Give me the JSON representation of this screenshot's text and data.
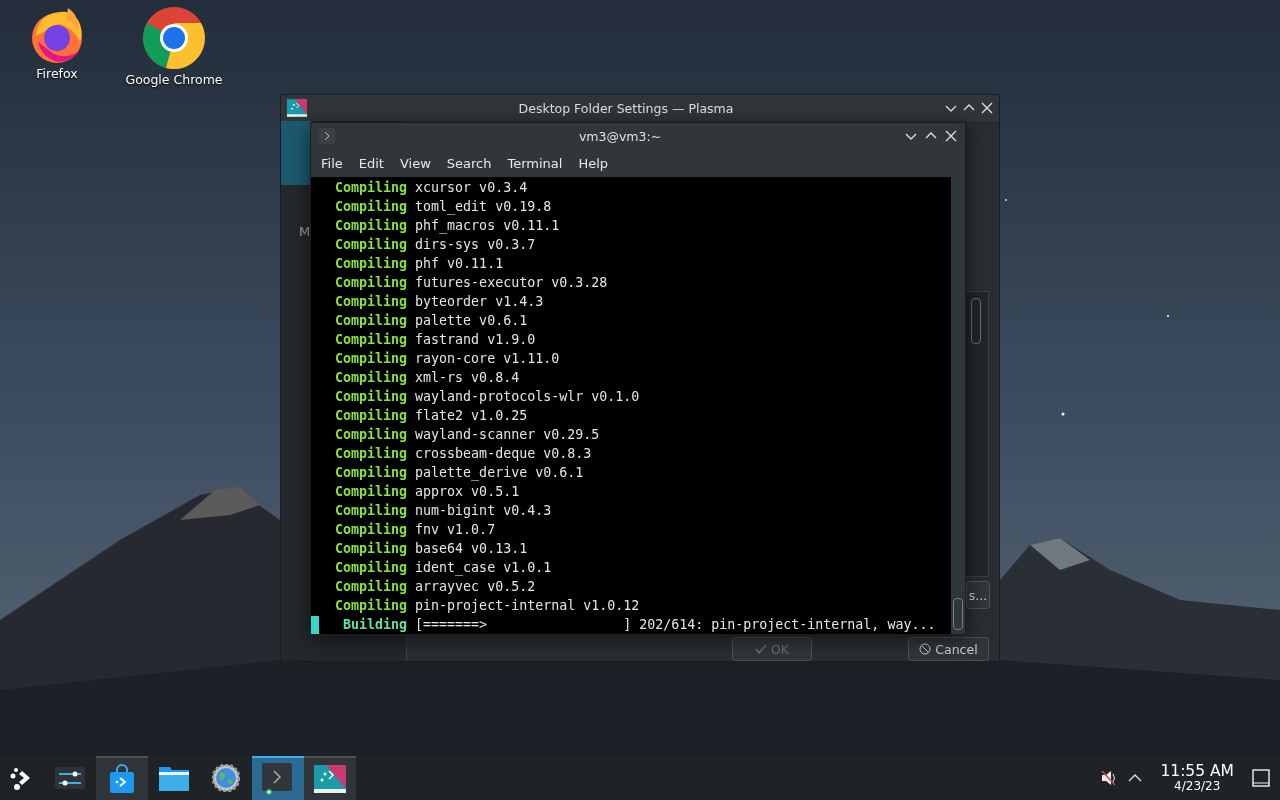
{
  "desktop_icons": [
    {
      "kind": "firefox",
      "label": "Firefox"
    },
    {
      "kind": "chrome",
      "label": "Google Chrome"
    }
  ],
  "back_window": {
    "title": "Desktop Folder Settings — Plasma",
    "side_label": "M",
    "buttons": [
      {
        "kind": "more",
        "label": "s...",
        "disabled": false
      },
      {
        "kind": "ok",
        "label": "OK",
        "disabled": true
      },
      {
        "kind": "cancel",
        "label": "Cancel",
        "disabled": false
      }
    ]
  },
  "terminal": {
    "title": "vm3@vm3:~",
    "menu": [
      "File",
      "Edit",
      "View",
      "Search",
      "Terminal",
      "Help"
    ],
    "lines": [
      {
        "kind": "compiling",
        "verb": "Compiling",
        "text": "xcursor v0.3.4"
      },
      {
        "kind": "compiling",
        "verb": "Compiling",
        "text": "toml_edit v0.19.8"
      },
      {
        "kind": "compiling",
        "verb": "Compiling",
        "text": "phf_macros v0.11.1"
      },
      {
        "kind": "compiling",
        "verb": "Compiling",
        "text": "dirs-sys v0.3.7"
      },
      {
        "kind": "compiling",
        "verb": "Compiling",
        "text": "phf v0.11.1"
      },
      {
        "kind": "compiling",
        "verb": "Compiling",
        "text": "futures-executor v0.3.28"
      },
      {
        "kind": "compiling",
        "verb": "Compiling",
        "text": "byteorder v1.4.3"
      },
      {
        "kind": "compiling",
        "verb": "Compiling",
        "text": "palette v0.6.1"
      },
      {
        "kind": "compiling",
        "verb": "Compiling",
        "text": "fastrand v1.9.0"
      },
      {
        "kind": "compiling",
        "verb": "Compiling",
        "text": "rayon-core v1.11.0"
      },
      {
        "kind": "compiling",
        "verb": "Compiling",
        "text": "xml-rs v0.8.4"
      },
      {
        "kind": "compiling",
        "verb": "Compiling",
        "text": "wayland-protocols-wlr v0.1.0"
      },
      {
        "kind": "compiling",
        "verb": "Compiling",
        "text": "flate2 v1.0.25"
      },
      {
        "kind": "compiling",
        "verb": "Compiling",
        "text": "wayland-scanner v0.29.5"
      },
      {
        "kind": "compiling",
        "verb": "Compiling",
        "text": "crossbeam-deque v0.8.3"
      },
      {
        "kind": "compiling",
        "verb": "Compiling",
        "text": "palette_derive v0.6.1"
      },
      {
        "kind": "compiling",
        "verb": "Compiling",
        "text": "approx v0.5.1"
      },
      {
        "kind": "compiling",
        "verb": "Compiling",
        "text": "num-bigint v0.4.3"
      },
      {
        "kind": "compiling",
        "verb": "Compiling",
        "text": "fnv v1.0.7"
      },
      {
        "kind": "compiling",
        "verb": "Compiling",
        "text": "base64 v0.13.1"
      },
      {
        "kind": "compiling",
        "verb": "Compiling",
        "text": "ident_case v1.0.1"
      },
      {
        "kind": "compiling",
        "verb": "Compiling",
        "text": "arrayvec v0.5.2"
      },
      {
        "kind": "compiling",
        "verb": "Compiling",
        "text": "pin-project-internal v1.0.12"
      },
      {
        "kind": "building",
        "verb": "Building",
        "text": "[=======>                 ] 202/614: pin-project-internal, way..."
      }
    ]
  },
  "taskbar": {
    "items": [
      {
        "kind": "launcher",
        "running": false,
        "selected": false
      },
      {
        "kind": "sliders",
        "running": false,
        "selected": false
      },
      {
        "kind": "store",
        "running": true,
        "selected": false
      },
      {
        "kind": "folder",
        "running": false,
        "selected": false
      },
      {
        "kind": "globe",
        "running": false,
        "selected": false
      },
      {
        "kind": "terminal",
        "running": true,
        "selected": true
      },
      {
        "kind": "plasma",
        "running": true,
        "selected": false
      }
    ],
    "tray": {
      "muted": true,
      "time": "11:55 AM",
      "date": "4/23/23"
    }
  }
}
